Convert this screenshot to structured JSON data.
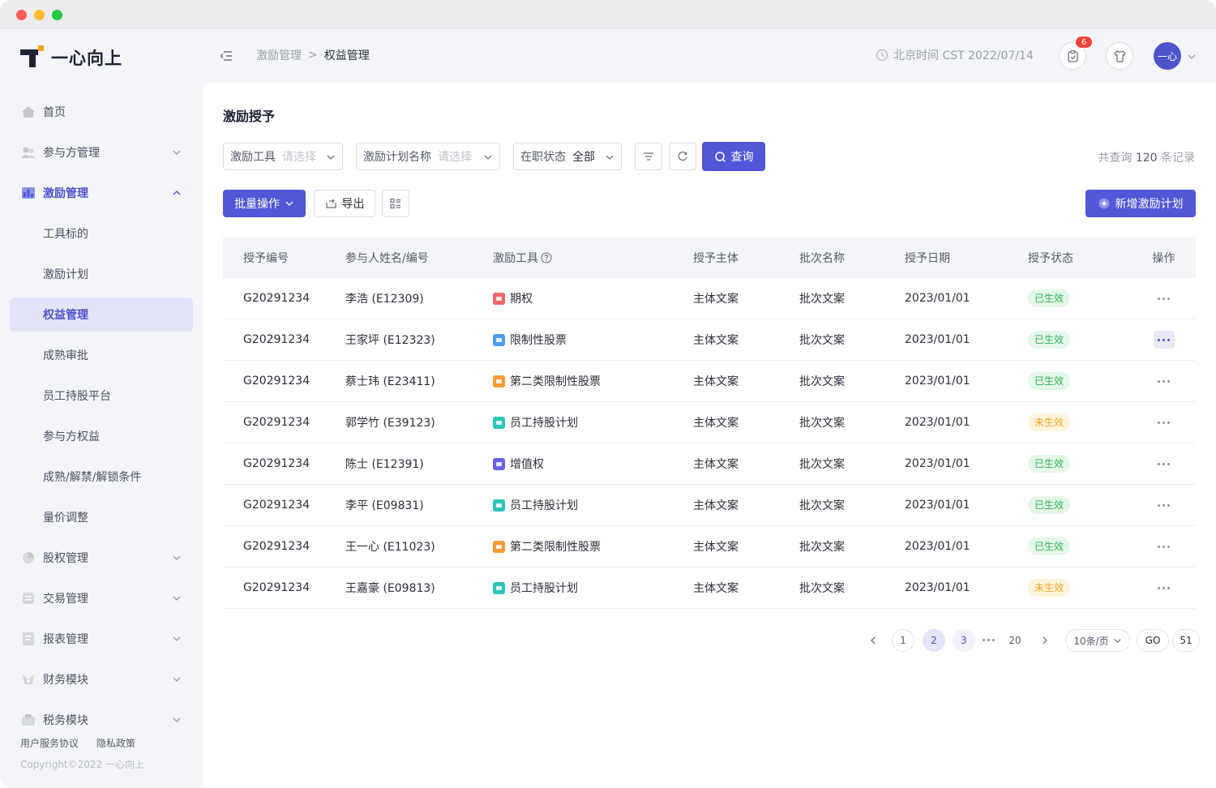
{
  "brand": {
    "name": "一心向上"
  },
  "sidebar": {
    "items": [
      {
        "label": "首页",
        "icon": "home-icon"
      },
      {
        "label": "参与方管理",
        "icon": "users-icon"
      },
      {
        "label": "激励管理",
        "icon": "incentive-icon"
      },
      {
        "label": "工具标的"
      },
      {
        "label": "激励计划"
      },
      {
        "label": "权益管理"
      },
      {
        "label": "成熟审批"
      },
      {
        "label": "员工持股平台"
      },
      {
        "label": "参与方权益"
      },
      {
        "label": "成熟/解禁/解锁条件"
      },
      {
        "label": "量价调整"
      },
      {
        "label": "股权管理",
        "icon": "equity-icon"
      },
      {
        "label": "交易管理",
        "icon": "trade-icon"
      },
      {
        "label": "报表管理",
        "icon": "report-icon"
      },
      {
        "label": "财务模块",
        "icon": "finance-icon"
      },
      {
        "label": "税务模块",
        "icon": "tax-icon"
      }
    ],
    "footer_links": [
      "用户服务协议",
      "隐私政策"
    ],
    "copyright": "Copyright©2022 一心向上"
  },
  "header": {
    "breadcrumb": [
      "激励管理",
      "权益管理"
    ],
    "breadcrumb_sep": ">",
    "clock_text": "北京时间 CST 2022/07/14",
    "notification_count": "6",
    "avatar_text": "一心"
  },
  "main": {
    "title": "激励授予",
    "filters": [
      {
        "label": "激励工具",
        "placeholder": "请选择"
      },
      {
        "label": "激励计划名称",
        "placeholder": "请选择"
      },
      {
        "label": "在职状态",
        "value": "全部"
      }
    ],
    "query_label": "查询",
    "record_count_prefix": "共查询",
    "record_count": "120",
    "record_count_suffix": "条记录",
    "batch_label": "批量操作",
    "export_label": "导出",
    "add_label": "新增激励计划"
  },
  "table": {
    "columns": [
      "授予编号",
      "参与人姓名/编号",
      "激励工具",
      "授予主体",
      "批次名称",
      "授予日期",
      "授予状态",
      "操作"
    ],
    "rows": [
      {
        "id": "G20291234",
        "person": "李浩 (E12309)",
        "tool": "期权",
        "tool_color": "#f0686a",
        "subject": "主体文案",
        "batch": "批次文案",
        "date": "2023/01/01",
        "status": "已生效",
        "status_kind": "ok"
      },
      {
        "id": "G20291234",
        "person": "王家坪 (E12323)",
        "tool": "限制性股票",
        "tool_color": "#4b9ef2",
        "subject": "主体文案",
        "batch": "批次文案",
        "date": "2023/01/01",
        "status": "已生效",
        "status_kind": "ok"
      },
      {
        "id": "G20291234",
        "person": "蔡士玮 (E23411)",
        "tool": "第二类限制性股票",
        "tool_color": "#f59b3b",
        "subject": "主体文案",
        "batch": "批次文案",
        "date": "2023/01/01",
        "status": "已生效",
        "status_kind": "ok"
      },
      {
        "id": "G20291234",
        "person": "郭学竹 (E39123)",
        "tool": "员工持股计划",
        "tool_color": "#2ec4b6",
        "subject": "主体文案",
        "batch": "批次文案",
        "date": "2023/01/01",
        "status": "未生效",
        "status_kind": "pending"
      },
      {
        "id": "G20291234",
        "person": "陈士 (E12391)",
        "tool": "增值权",
        "tool_color": "#6b62e8",
        "subject": "主体文案",
        "batch": "批次文案",
        "date": "2023/01/01",
        "status": "已生效",
        "status_kind": "ok"
      },
      {
        "id": "G20291234",
        "person": "李平 (E09831)",
        "tool": "员工持股计划",
        "tool_color": "#2ec4b6",
        "subject": "主体文案",
        "batch": "批次文案",
        "date": "2023/01/01",
        "status": "已生效",
        "status_kind": "ok"
      },
      {
        "id": "G20291234",
        "person": "王一心 (E11023)",
        "tool": "第二类限制性股票",
        "tool_color": "#f59b3b",
        "subject": "主体文案",
        "batch": "批次文案",
        "date": "2023/01/01",
        "status": "已生效",
        "status_kind": "ok"
      },
      {
        "id": "G20291234",
        "person": "王嘉豪 (E09813)",
        "tool": "员工持股计划",
        "tool_color": "#2ec4b6",
        "subject": "主体文案",
        "batch": "批次文案",
        "date": "2023/01/01",
        "status": "未生效",
        "status_kind": "pending"
      }
    ]
  },
  "pagination": {
    "pages": [
      "1",
      "2",
      "3",
      "20"
    ],
    "page_size": "10条/页",
    "go_label": "GO",
    "jump_value": "51"
  },
  "colors": {
    "accent": "#5356d6",
    "active_bg": "#e3e4f7",
    "ok": "#31b65c",
    "pending": "#f2a824"
  }
}
